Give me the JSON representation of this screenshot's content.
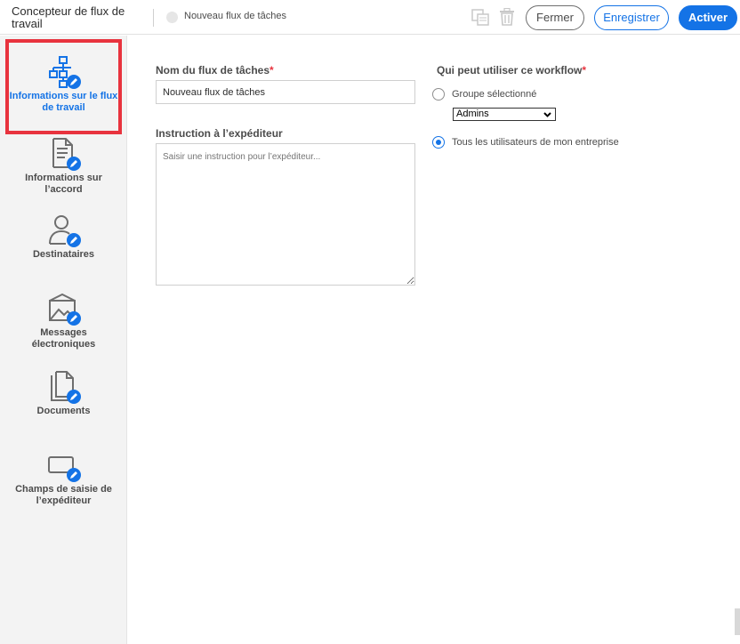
{
  "header": {
    "app_title": "Concepteur de flux de travail",
    "workflow_name": "Nouveau flux de tâches",
    "icons": [
      "copy-icon",
      "trash-icon"
    ],
    "buttons": {
      "close": "Fermer",
      "save": "Enregistrer",
      "activate": "Activer"
    }
  },
  "sidebar": {
    "items": [
      {
        "label": "Informations sur le flux de travail",
        "icon": "workflow-info-icon",
        "active": true
      },
      {
        "label": "Informations sur l’accord",
        "icon": "agreement-info-icon",
        "active": false
      },
      {
        "label": "Destinataires",
        "icon": "recipients-icon",
        "active": false
      },
      {
        "label": "Messages électroniques",
        "icon": "emails-icon",
        "active": false
      },
      {
        "label": "Documents",
        "icon": "documents-icon",
        "active": false
      },
      {
        "label": "Champs de saisie de l’expéditeur",
        "icon": "sender-fields-icon",
        "active": false
      }
    ]
  },
  "form": {
    "name_label": "Nom du flux de tâches",
    "name_value": "Nouveau flux de tâches",
    "instruction_label": "Instruction à l’expéditeur",
    "instruction_placeholder": "Saisir une instruction pour l’expéditeur...",
    "who_label": "Qui peut utiliser ce workflow",
    "required_mark": "*",
    "option_group": "Groupe sélectionné",
    "group_selected": "Admins",
    "option_all": "Tous les utilisateurs de mon entreprise",
    "selected_option": "all"
  },
  "colors": {
    "accent": "#1473e6",
    "required": "#e8333e",
    "highlight": "#e8333e"
  }
}
